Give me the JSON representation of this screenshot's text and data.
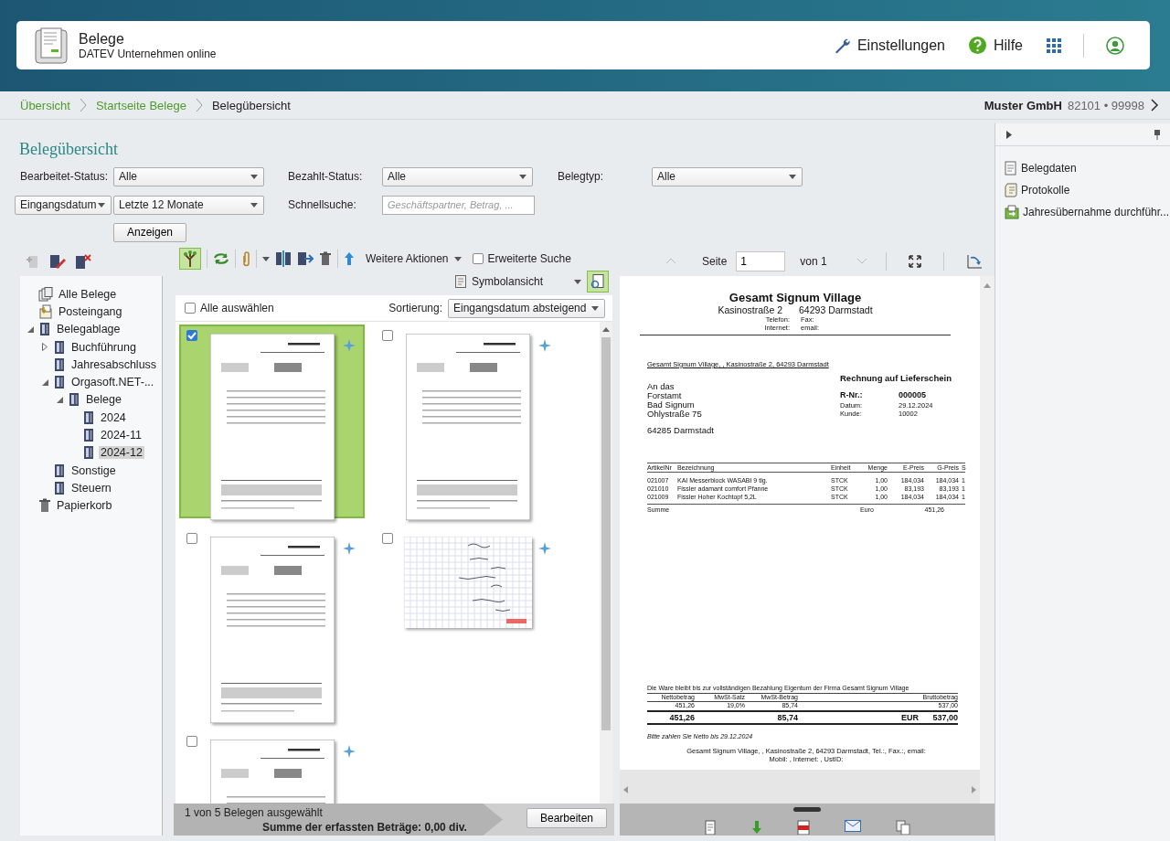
{
  "header": {
    "title": "Belege",
    "subtitle": "DATEV Unternehmen online",
    "actions": [
      {
        "kind": "settings",
        "label": "Einstellungen"
      },
      {
        "kind": "help",
        "label": "Hilfe"
      },
      {
        "kind": "apps"
      },
      {
        "kind": "account"
      }
    ]
  },
  "breadcrumb": [
    {
      "label": "Übersicht",
      "link": true
    },
    {
      "label": "Startseite Belege",
      "link": true
    },
    {
      "label": "Belegübersicht",
      "link": false
    }
  ],
  "client": {
    "name": "Muster GmbH",
    "number": "82101 • 99998"
  },
  "page_title": "Belegübersicht",
  "filters": [
    [
      {
        "kind": "label",
        "text": "Bearbeitet-Status:"
      },
      {
        "kind": "select",
        "value": "Alle"
      },
      {
        "kind": "label",
        "text": "Bezahlt-Status:"
      },
      {
        "kind": "select",
        "value": "Alle"
      },
      {
        "kind": "label",
        "text": "Belegtyp:"
      },
      {
        "kind": "select",
        "value": "Alle"
      }
    ],
    [
      {
        "kind": "select",
        "value": "Eingangsdatum"
      },
      {
        "kind": "select",
        "value": "Letzte 12 Monate"
      },
      {
        "kind": "label",
        "text": "Schnellsuche:"
      },
      {
        "kind": "input",
        "placeholder": "Geschäftspartner, Betrag, ..."
      }
    ],
    [
      {
        "kind": "button",
        "label": "Anzeigen"
      }
    ]
  ],
  "tree": [
    {
      "label": "Alle Belege",
      "kind": "all",
      "selected": false
    },
    {
      "label": "Posteingang",
      "kind": "inbox",
      "selected": false
    },
    {
      "label": "Belegablage",
      "kind": "folder",
      "selected": false,
      "expanded": true,
      "children": [
        {
          "label": "Buchführung",
          "kind": "folder",
          "selected": false,
          "expanded": false
        },
        {
          "label": "Jahresabschluss",
          "kind": "folder",
          "selected": false
        },
        {
          "label": "Orgasoft.NET-...",
          "kind": "folder",
          "selected": false,
          "expanded": true,
          "children": [
            {
              "label": "Belege",
              "kind": "folder",
              "selected": false,
              "expanded": true,
              "children": [
                {
                  "label": "2024",
                  "kind": "folder",
                  "selected": false
                },
                {
                  "label": "2024-11",
                  "kind": "folder",
                  "selected": false
                },
                {
                  "label": "2024-12",
                  "kind": "folder",
                  "selected": true
                }
              ]
            }
          ]
        },
        {
          "label": "Sonstige",
          "kind": "folder",
          "selected": false
        },
        {
          "label": "Steuern",
          "kind": "folder",
          "selected": false
        }
      ]
    },
    {
      "label": "Papierkorb",
      "kind": "trash",
      "selected": false
    }
  ],
  "list_toolbar": {
    "tree_toggle_on": true,
    "more_actions": "Weitere Aktionen",
    "advanced_search": {
      "label": "Erweiterte Suche",
      "checked": false
    },
    "view": "Symbolansicht",
    "preview_on": true
  },
  "selection": {
    "select_all": {
      "label": "Alle auswählen",
      "checked": false
    },
    "sort_label": "Sortierung:",
    "sort_value": "Eingangsdatum absteigend"
  },
  "documents": [
    {
      "kind": "invoice",
      "selected": true,
      "checked": true
    },
    {
      "kind": "invoice",
      "selected": false,
      "checked": false
    },
    {
      "kind": "invoice",
      "selected": false,
      "checked": false
    },
    {
      "kind": "handwritten",
      "selected": false,
      "checked": false
    },
    {
      "kind": "invoice",
      "selected": false,
      "checked": false
    }
  ],
  "status": {
    "count": "1 von 5 Belegen ausgewählt",
    "sum": "Summe der erfassten Beträge: 0,00 div.",
    "button": "Bearbeiten"
  },
  "viewer": {
    "page_label": "Seite",
    "page_value": "1",
    "page_total": "von 1",
    "document": {
      "company": "Gesamt Signum Village",
      "address": [
        "Kasinostraße 2",
        "64293 Darmstadt"
      ],
      "contact": [
        [
          "Telefon:",
          "Fax:"
        ],
        [
          "Internet:",
          "email:"
        ]
      ],
      "sender_line": "Gesamt Signum Village, , Kasinostraße 2, 64293 Darmstadt",
      "title": "Rechnung auf Lieferschein",
      "recipient": [
        "An das",
        "Forstamt",
        "Bad Signum",
        "Ohlystraße 75"
      ],
      "city": "64285 Darmstadt",
      "meta": [
        {
          "kind": "strong",
          "label": "R-Nr.:",
          "value": "000005"
        },
        {
          "kind": "plain",
          "label": "Datum:",
          "value": "29.12.2024"
        },
        {
          "kind": "plain",
          "label": "Kunde:",
          "value": "10002"
        }
      ],
      "columns": [
        "ArtikelNr",
        "Bezeichnung",
        "Einheit",
        "Menge",
        "E-Preis",
        "G-Preis",
        "S"
      ],
      "rows": [
        [
          "021007",
          "KAI Messerblock WASABI 9 tlg.",
          "STCK",
          "1,00",
          "184,034",
          "184,034",
          "1"
        ],
        [
          "021010",
          "Fissler adamant comfort Pfanne",
          "STCK",
          "1,00",
          "83,193",
          "83,193",
          "1"
        ],
        [
          "021009",
          "Fissler Hoher Kochtopf 5,2L",
          "STCK",
          "1,00",
          "184,034",
          "184,034",
          "1"
        ]
      ],
      "sum": {
        "label": "Summe",
        "currency": "Euro",
        "value": "451,26"
      },
      "note": "Die Ware bleibt bis zur vollständigen Bezahlung Eigentum der Firma Gesamt Signum Village",
      "totals_columns": [
        "Nettobetrag",
        "MwSt-Satz",
        "MwSt-Betrag",
        "Bruttobetrag"
      ],
      "totals_row": [
        "451,26",
        "19,0%",
        "85,74",
        "537,00"
      ],
      "grand_total": {
        "net": "451,26",
        "tax": "85,74",
        "currency": "EUR",
        "gross": "537,00"
      },
      "payment": "Bitte zahlen Sie Netto bis 29.12.2024",
      "footer": [
        "Gesamt Signum Village, , Kasinostraße 2, 64293 Darmstadt, Tel.:, Fax.:, email:",
        "Mobil: , Internet: , UstID:"
      ]
    }
  },
  "side_panel": {
    "items": [
      {
        "kind": "data",
        "label": "Belegdaten"
      },
      {
        "kind": "log",
        "label": "Protokolle"
      },
      {
        "kind": "transfer",
        "label": "Jahresübernahme durchführ..."
      }
    ]
  }
}
